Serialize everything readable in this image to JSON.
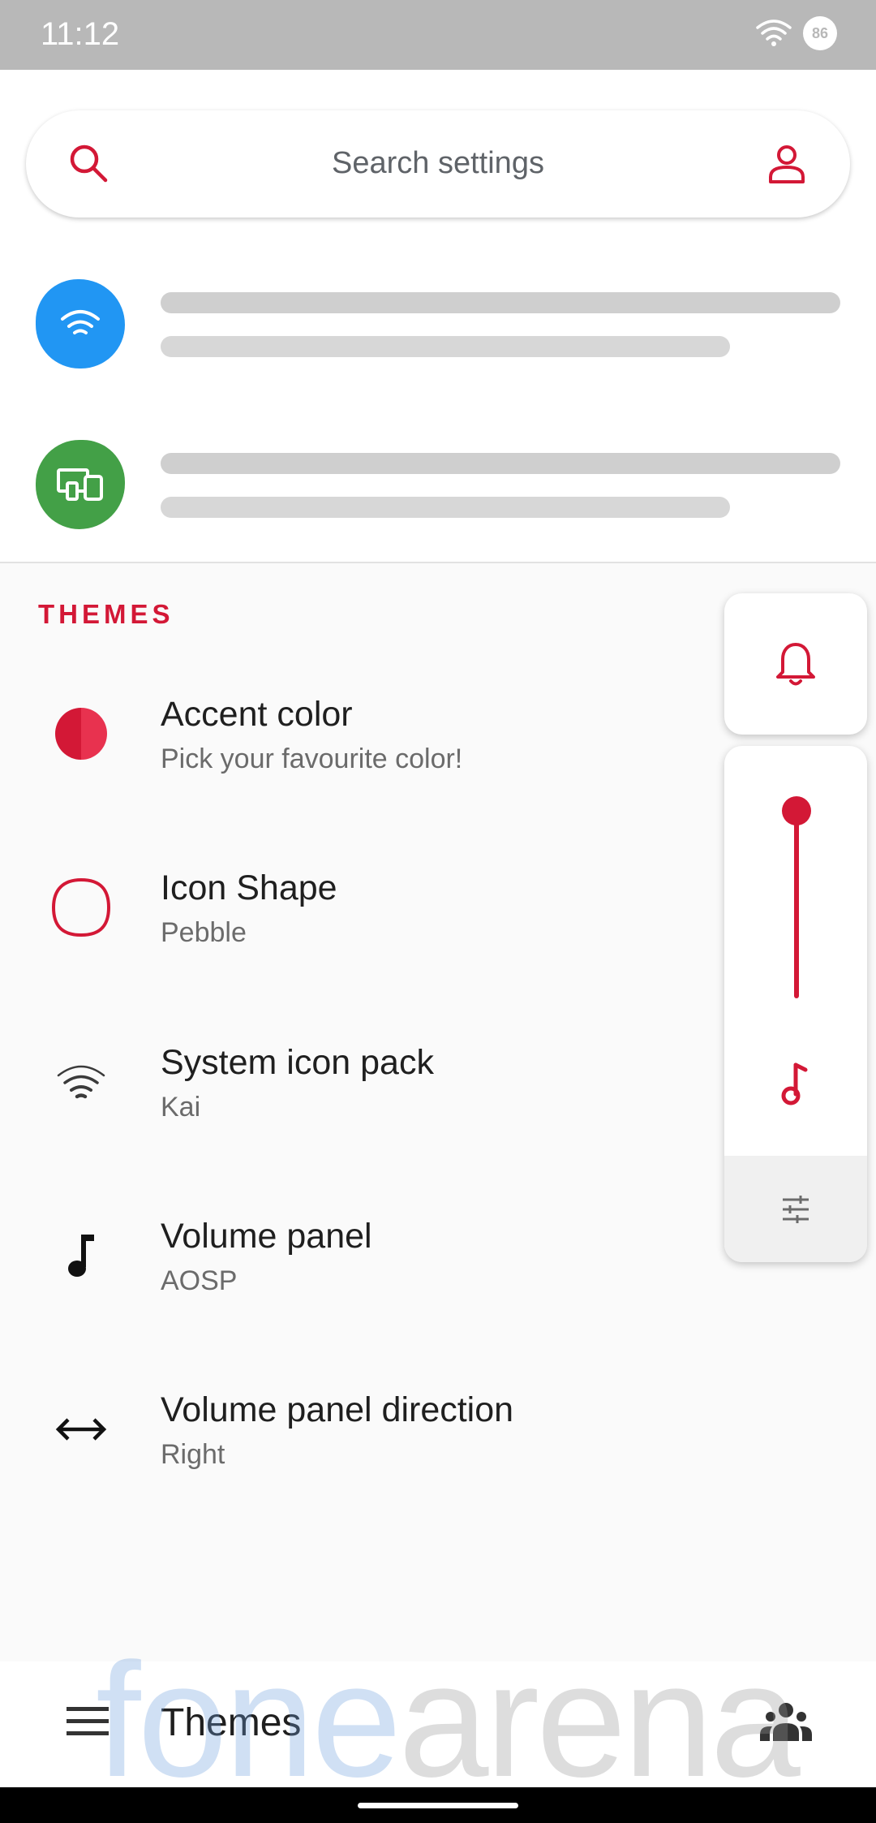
{
  "status_bar": {
    "time": "11:12",
    "battery": "86"
  },
  "search": {
    "placeholder": "Search settings"
  },
  "section": {
    "header": "THEMES"
  },
  "settings": [
    {
      "title": "Accent color",
      "subtitle": "Pick your favourite color!",
      "icon": "accent-color-icon"
    },
    {
      "title": "Icon Shape",
      "subtitle": "Pebble",
      "icon": "pebble-shape-icon"
    },
    {
      "title": "System icon pack",
      "subtitle": "Kai",
      "icon": "wifi-icon"
    },
    {
      "title": "Volume panel",
      "subtitle": "AOSP",
      "icon": "music-note-icon"
    },
    {
      "title": "Volume panel direction",
      "subtitle": "Right",
      "icon": "horizontal-arrows-icon"
    }
  ],
  "volume_panel": {
    "level": 1.0
  },
  "bottom_bar": {
    "title": "Themes"
  },
  "watermark": {
    "part1": "fone",
    "part2": "arena"
  },
  "colors": {
    "accent": "#d31836",
    "wifi_blue": "#2196f3",
    "device_green": "#43a047",
    "status_bar": "#b8b8b8"
  }
}
